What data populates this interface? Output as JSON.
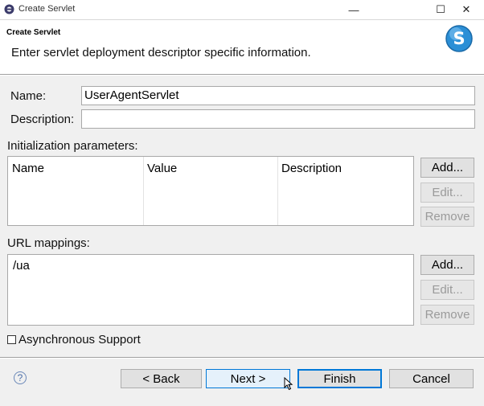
{
  "window": {
    "title": "Create Servlet",
    "minimize_icon": "minimize-icon",
    "maximize_icon": "maximize-icon",
    "close_icon": "close-icon",
    "minimize_glyph": "—",
    "maximize_glyph": "☐",
    "close_glyph": "✕"
  },
  "banner": {
    "title": "Create Servlet",
    "message": "Enter servlet deployment descriptor specific information.",
    "logo_icon": "servlet-logo-icon"
  },
  "form": {
    "name_label": "Name:",
    "name_value": "UserAgentServlet",
    "description_label": "Description:",
    "description_value": ""
  },
  "init_params": {
    "label": "Initialization parameters:",
    "columns": [
      "Name",
      "Value",
      "Description"
    ],
    "buttons": {
      "add": "Add...",
      "edit": "Edit...",
      "remove": "Remove"
    }
  },
  "url_mappings": {
    "label": "URL mappings:",
    "items": [
      "/ua"
    ],
    "buttons": {
      "add": "Add...",
      "edit": "Edit...",
      "remove": "Remove"
    }
  },
  "async": {
    "label": "Asynchronous Support",
    "checked": false
  },
  "footer": {
    "help_glyph": "?",
    "back": "< Back",
    "next": "Next >",
    "finish": "Finish",
    "cancel": "Cancel"
  },
  "colors": {
    "accent": "#0078d7",
    "logo": "#2b8fd6"
  }
}
